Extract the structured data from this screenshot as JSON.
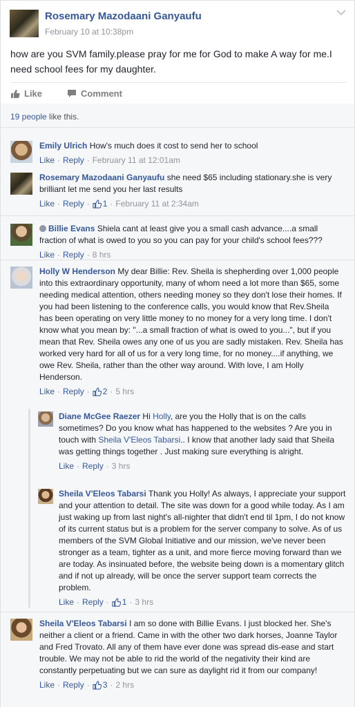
{
  "post": {
    "author": "Rosemary Mazodaani Ganyaufu",
    "timestamp": "February 10 at 10:38pm",
    "text": "how are you SVM family.please pray for me for God to make A way for me.I need school fees for my daughter.",
    "like_label": "Like",
    "comment_label": "Comment"
  },
  "likes": {
    "count_text": "19 people",
    "suffix": " like this."
  },
  "comments": [
    {
      "author": "Emily Ulrich",
      "text": "How's much does it cost to send her to school",
      "like": "Like",
      "reply": "Reply",
      "time": "February 11 at 12:01am"
    },
    {
      "author": "Rosemary Mazodaani Ganyaufu",
      "text": "she need $65 including stationary.she is very brilliant let me send you her last results",
      "like": "Like",
      "reply": "Reply",
      "likes": "1",
      "time": "February 11 at 2:34am"
    },
    {
      "author": "Billie Evans",
      "text": "Shiela cant at least give you a small cash advance....a small fraction of what is owed to you so you can pay for your child's school fees???",
      "like": "Like",
      "reply": "Reply",
      "time": "8 hrs"
    },
    {
      "author": "Holly W Henderson",
      "text": "My dear Billie: Rev. Sheila is shepherding over 1,000 people into this extraordinary opportunity, many of whom need a lot more than $65, some needing medical attention, others needing money so they don't lose their homes. If you had been listening to the conference calls, you would know that Rev.Sheila has been operating on very little money to no money for a very long time. I don't know what you mean by: \"...a small fraction of what is owed to you...\", but if you mean that Rev. Sheila owes any one of us you are sadly mistaken. Rev. Sheila has worked very hard for all of us for a very long time, for no money....if anything, we owe Rev. Sheila, rather than the other way around. With love, I am Holly Henderson.",
      "like": "Like",
      "reply": "Reply",
      "likes": "2",
      "time": "5 hrs"
    },
    {
      "author": "Diane McGee Raezer",
      "text_a": "Hi ",
      "mention_1": "Holly",
      "text_b": ", are you the Holly that is on the calls sometimes? Do you know what has happened to the websites ? Are you in touch with ",
      "mention_2": "Sheila V'Eleos Tabarsi",
      "text_c": ".. I know that another lady said that Sheila was getting things together . Just making sure everything is alright.",
      "like": "Like",
      "reply": "Reply",
      "time": "3 hrs"
    },
    {
      "author": "Sheila V'Eleos Tabarsi",
      "text": "Thank you Holly! As always, I appreciate your support and your attention to detail. The site was down for a good while today. As I am just waking up from last night's all-nighter that didn't end til 1pm, I do not know of its current status but is a problem for the server company to solve. As of us members of the SVM Global Initiative and our mission, we've never been stronger as a team, tighter as a unit, and more fierce moving forward than we are today. As insinuated before, the website being down is a momentary glitch and if not up already, will be once the server support team corrects the problem.",
      "like": "Like",
      "reply": "Reply",
      "likes": "1",
      "time": "3 hrs"
    },
    {
      "author": "Sheila V'Eleos Tabarsi",
      "text": "I am so done with Billie Evans. I just blocked her. She's neither a client or a friend. Came in with the other two dark horses, Joanne Taylor and Fred Trovato. All any of them have ever done was spread dis-ease and start trouble. We may not be able to rid the world of the negativity their kind are constantly perpetuating but we can sure as daylight rid it from our company!",
      "like": "Like",
      "reply": "Reply",
      "likes": "3",
      "time": "2 hrs"
    }
  ]
}
